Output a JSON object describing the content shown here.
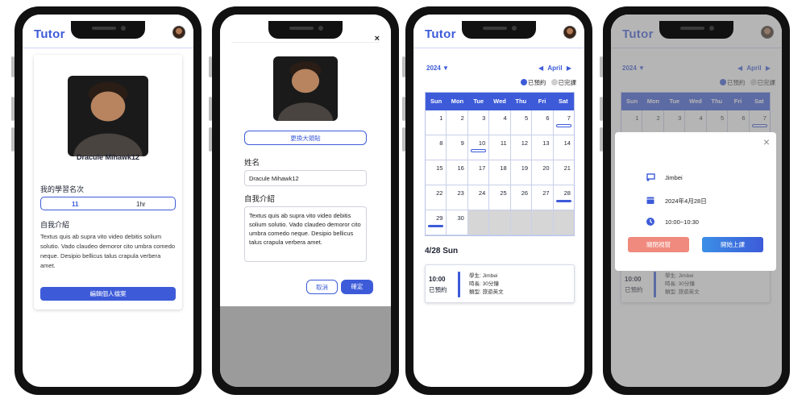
{
  "brand": "Tutor",
  "profile": {
    "name": "Dracule Mihawk12",
    "stats_label": "我的學習名次",
    "stat_rank": "11",
    "stat_hours": "1hr",
    "bio_label": "自我介紹",
    "bio": "Textus quis ab supra vito video debitis solium solutio. Vado claudeo demoror cito umbra comedo neque. Desipio bellicus talus crapula verbera amet.",
    "edit_button": "編輯個人檔案"
  },
  "edit": {
    "close": "×",
    "change_avatar": "更換大頭貼",
    "name_label": "姓名",
    "name_value": "Dracule Mihawk12",
    "bio_label": "自我介紹",
    "bio_value": "Textus quis ab supra vito video debitis solium solutio. Vado claudeo demoror cito umbra comedo neque. Desipio bellicus talus crapula verbera amet.",
    "cancel": "取消",
    "confirm": "確定"
  },
  "calendar": {
    "year": "2024",
    "month": "April",
    "legend_booked": "已預約",
    "legend_done": "已完課",
    "weekdays": [
      "Sun",
      "Mon",
      "Tue",
      "Wed",
      "Thu",
      "Fri",
      "Sat"
    ],
    "weeks": [
      [
        "",
        "1",
        "2",
        "3",
        "4",
        "5",
        "6",
        "7"
      ],
      [
        "8",
        "9",
        "10",
        "11",
        "12",
        "13",
        "14"
      ],
      [
        "15",
        "16",
        "17",
        "18",
        "19",
        "20",
        "21"
      ],
      [
        "22",
        "23",
        "24",
        "25",
        "26",
        "27",
        "28"
      ],
      [
        "29",
        "30",
        "",
        "",
        "",
        "",
        ""
      ]
    ],
    "day_title": "4/28 Sun",
    "lesson": {
      "time": "10:00",
      "status": "已預約",
      "student": "學生: Jimbei",
      "duration": "時長: 30分鐘",
      "type": "類型: 旅遊英文"
    }
  },
  "modal": {
    "close": "×",
    "student": "Jimbei",
    "date": "2024年4月28日",
    "time": "10:00~10:30",
    "close_button": "關閉視窗",
    "start_button": "開始上課"
  },
  "colors": {
    "accent": "#3d5bd9",
    "danger": "#f08a7e",
    "muted": "#cfcfcf"
  }
}
